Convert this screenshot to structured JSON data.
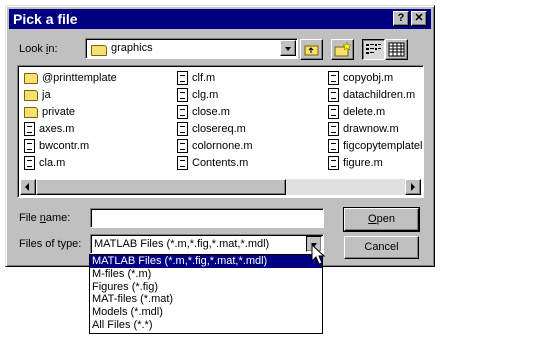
{
  "dialog": {
    "title": "Pick a file",
    "help_btn": "?",
    "close_btn": "✕"
  },
  "look_in": {
    "label_pre": "Look ",
    "label_u": "i",
    "label_post": "n:",
    "value": "graphics"
  },
  "files": {
    "col1": [
      {
        "name": "@printtemplate",
        "type": "folder"
      },
      {
        "name": "ja",
        "type": "folder"
      },
      {
        "name": "private",
        "type": "folder"
      },
      {
        "name": "axes.m",
        "type": "file"
      },
      {
        "name": "bwcontr.m",
        "type": "file"
      },
      {
        "name": "cla.m",
        "type": "file"
      }
    ],
    "col2": [
      {
        "name": "clf.m",
        "type": "file"
      },
      {
        "name": "clg.m",
        "type": "file"
      },
      {
        "name": "close.m",
        "type": "file"
      },
      {
        "name": "closereq.m",
        "type": "file"
      },
      {
        "name": "colornone.m",
        "type": "file"
      },
      {
        "name": "Contents.m",
        "type": "file"
      }
    ],
    "col3": [
      {
        "name": "copyobj.m",
        "type": "file"
      },
      {
        "name": "datachildren.m",
        "type": "file"
      },
      {
        "name": "delete.m",
        "type": "file"
      },
      {
        "name": "drawnow.m",
        "type": "file"
      },
      {
        "name": "figcopytemplatelis",
        "type": "file"
      },
      {
        "name": "figure.m",
        "type": "file"
      }
    ]
  },
  "file_name": {
    "label_pre": "File ",
    "label_u": "n",
    "label_post": "ame:",
    "value": ""
  },
  "files_of_type": {
    "label": "Files of type:",
    "value": "MATLAB Files (*.m,*.fig,*.mat,*.mdl)",
    "options": [
      "MATLAB Files (*.m,*.fig,*.mat,*.mdl)",
      "M-files (*.m)",
      "Figures (*.fig)",
      "MAT-files (*.mat)",
      "Models (*.mdl)",
      "All Files (*.*)"
    ],
    "selected_index": 0
  },
  "buttons": {
    "open_u": "O",
    "open_rest": "pen",
    "cancel": "Cancel"
  },
  "icons": {
    "folder": "folder-icon",
    "file": "m-file-icon",
    "up": "up-one-level-icon",
    "new_folder": "new-folder-icon",
    "list": "list-view-icon",
    "details": "details-view-icon"
  },
  "colors": {
    "title_bar": "#000080",
    "dialog_bg": "#c0c0c0",
    "selection": "#000080"
  }
}
